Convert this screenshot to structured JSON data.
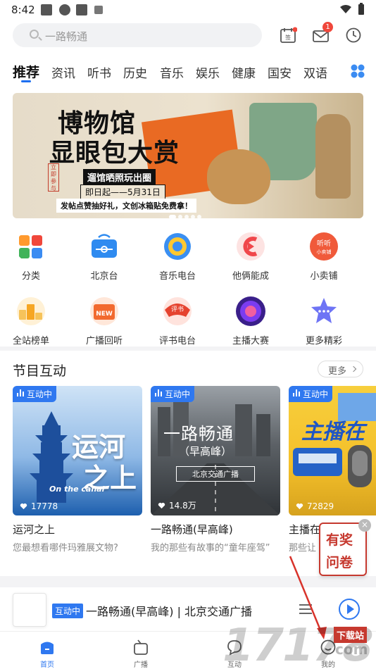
{
  "status_bar": {
    "time": "8:42"
  },
  "search": {
    "placeholder": "一路畅通"
  },
  "header": {
    "notification_count": "1"
  },
  "tabs": [
    "推荐",
    "资讯",
    "听书",
    "历史",
    "音乐",
    "娱乐",
    "健康",
    "国安",
    "双语"
  ],
  "banner": {
    "title_line1": "博物馆",
    "title_line2": "显眼包大赏",
    "subtitle": "遛馆晒照玩出圈",
    "date": "即日起——5月31日",
    "promo": "发帖点赞抽好礼，文创冰箱贴免费拿！",
    "stamp": "立即参与",
    "page_count": 5,
    "active_page": 1
  },
  "grid": [
    {
      "label": "分类",
      "icon": "category-icon",
      "color": "#ff9a2e"
    },
    {
      "label": "北京台",
      "icon": "radio-station-icon",
      "color": "#2f8bf0"
    },
    {
      "label": "音乐电台",
      "icon": "music-radio-icon",
      "color": "#3a8ff2"
    },
    {
      "label": "他俩能成",
      "icon": "couple-show-icon",
      "color": "#f0474b"
    },
    {
      "label": "小卖铺",
      "icon": "shop-icon",
      "color": "#f05a3a"
    },
    {
      "label": "全站榜单",
      "icon": "ranking-icon",
      "color": "#f6a623"
    },
    {
      "label": "广播回听",
      "icon": "replay-icon",
      "color": "#f26a2f"
    },
    {
      "label": "评书电台",
      "icon": "storytelling-icon",
      "color": "#e5432f"
    },
    {
      "label": "主播大赛",
      "icon": "host-contest-icon",
      "color": "#7b3cf0"
    },
    {
      "label": "更多精彩",
      "icon": "more-icon",
      "color": "#6e74f5"
    }
  ],
  "section": {
    "title": "节目互动",
    "more_label": "更多"
  },
  "cards": [
    {
      "badge": "互动中",
      "likes": "17778",
      "title": "运河之上",
      "desc": "您最想看哪件玛雅展文物?",
      "art_line1": "运河",
      "art_line2": "之上",
      "art_caption": "On the canal"
    },
    {
      "badge": "互动中",
      "likes": "14.8万",
      "title": "一路畅通(早高峰)",
      "desc": "我的那些有故事的“童年座驾”",
      "art_line1": "一路畅通",
      "art_line2": "（早高峰）",
      "art_caption": "北京交通广播"
    },
    {
      "badge": "互动中",
      "likes": "72829",
      "title": "主播在",
      "desc": "那些让",
      "art_line1": "主播在",
      "art_line2": "",
      "art_caption": ""
    }
  ],
  "player": {
    "tag": "互动中",
    "title": "一路畅通(早高峰) | 北京交通广播"
  },
  "survey": {
    "line1": "有奖",
    "line2": "问卷",
    "close": "×"
  },
  "nav": [
    {
      "label": "首页",
      "icon": "home-icon",
      "active": true
    },
    {
      "label": "广播",
      "icon": "broadcast-icon",
      "active": false
    },
    {
      "label": "互动",
      "icon": "interaction-icon",
      "active": false
    },
    {
      "label": "我的",
      "icon": "profile-icon",
      "active": false
    }
  ],
  "watermark": {
    "main": "17178",
    "badge": "下载站",
    "suffix": "com"
  },
  "colors": {
    "accent": "#2f78f0",
    "banner_orange": "#e96a23",
    "survey_red": "#c6392f"
  }
}
